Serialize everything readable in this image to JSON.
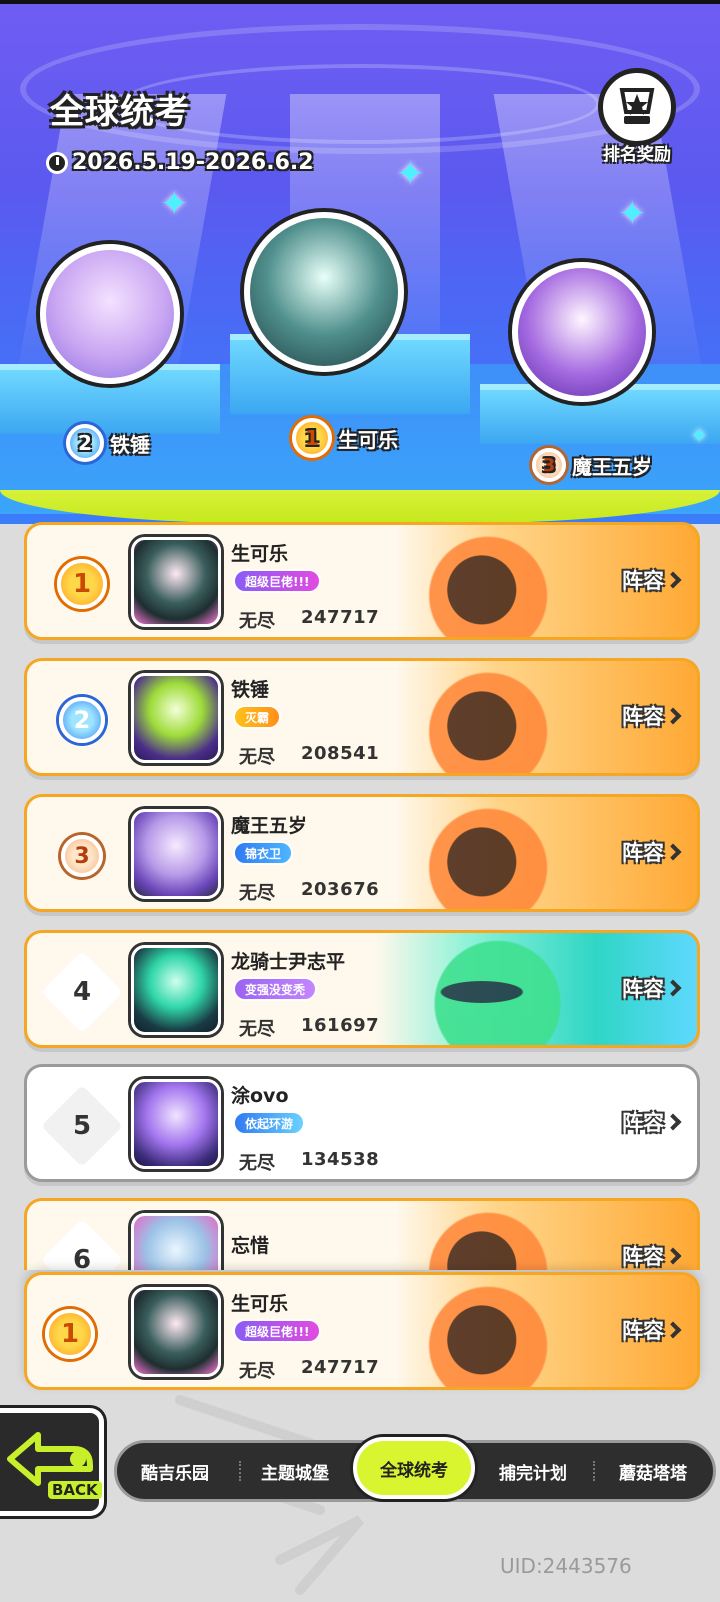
{
  "header": {
    "title": "全球统考",
    "date_range": "2026.5.19-2026.6.2",
    "reward_label": "排名奖励"
  },
  "podium": [
    {
      "rank": "2",
      "name": "铁锤"
    },
    {
      "rank": "1",
      "name": "生可乐"
    },
    {
      "rank": "3",
      "name": "魔王五岁"
    }
  ],
  "leaderboard": [
    {
      "rank": "1",
      "name": "生可乐",
      "badge": "超级巨佬!!!",
      "mode": "无尽",
      "score": "247717",
      "action": "阵容"
    },
    {
      "rank": "2",
      "name": "铁锤",
      "badge": "灭霸",
      "mode": "无尽",
      "score": "208541",
      "action": "阵容"
    },
    {
      "rank": "3",
      "name": "魔王五岁",
      "badge": "锦衣卫",
      "mode": "无尽",
      "score": "203676",
      "action": "阵容"
    },
    {
      "rank": "4",
      "name": "龙骑士尹志平",
      "badge": "变强没变秃",
      "mode": "无尽",
      "score": "161697",
      "action": "阵容"
    },
    {
      "rank": "5",
      "name": "涂ovo",
      "badge": "依起环游",
      "mode": "无尽",
      "score": "134538",
      "action": "阵容"
    },
    {
      "rank": "6",
      "name": "忘惜",
      "action": "阵容"
    }
  ],
  "my_rank": {
    "rank": "1",
    "name": "生可乐",
    "badge": "超级巨佬!!!",
    "mode": "无尽",
    "score": "247717",
    "action": "阵容"
  },
  "nav": {
    "back_label": "BACK",
    "tabs": [
      "酷吉乐园",
      "主题城堡",
      "全球统考",
      "捕完计划",
      "蘑菇塔塔"
    ],
    "active_tab": "全球统考"
  },
  "uid": "UID:2443576",
  "colors": {
    "accent_lime": "#d8f530",
    "gold_border": "#f5a623",
    "stage_purple": "#6f5df2"
  }
}
